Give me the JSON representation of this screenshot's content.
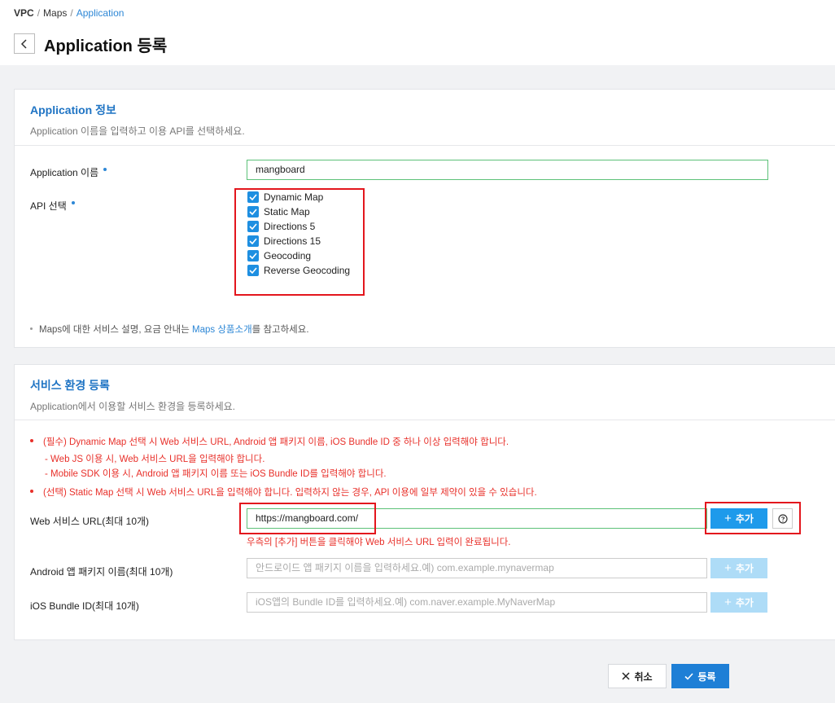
{
  "breadcrumb": {
    "root": "VPC",
    "sep1": "/",
    "section": "Maps",
    "sep2": "/",
    "current": "Application"
  },
  "page": {
    "title": "Application 등록"
  },
  "app_info": {
    "title": "Application 정보",
    "description": "Application 이름을 입력하고 이용 API를 선택하세요.",
    "name_label": "Application 이름",
    "name_value": "mangboard",
    "api_label": "API 선택",
    "apis": [
      {
        "label": "Dynamic Map",
        "checked": true
      },
      {
        "label": "Static Map",
        "checked": true
      },
      {
        "label": "Directions 5",
        "checked": true
      },
      {
        "label": "Directions 15",
        "checked": true
      },
      {
        "label": "Geocoding",
        "checked": true
      },
      {
        "label": "Reverse Geocoding",
        "checked": true
      }
    ],
    "note_prefix": "Maps에 대한 서비스 설명, 요금 안내는 ",
    "note_link": "Maps 상품소개",
    "note_suffix": "를 참고하세요."
  },
  "service_env": {
    "title": "서비스 환경 등록",
    "description": "Application에서 이용할 서비스 환경을 등록하세요.",
    "warnings": {
      "required": "(필수) Dynamic Map 선택 시 Web 서비스 URL, Android 앱 패키지 이름, iOS Bundle ID 중 하나 이상 입력해야 합니다.",
      "sub1": "- Web JS 이용 시, Web 서비스 URL을 입력해야 합니다.",
      "sub2": "- Mobile SDK 이용 시, Android 앱 패키지 이름 또는 iOS Bundle ID를 입력해야 합니다.",
      "optional": "(선택) Static Map 선택 시 Web 서비스 URL을 입력해야 합니다. 입력하지 않는 경우, API 이용에 일부 제약이 있을 수 있습니다."
    },
    "web_url": {
      "label": "Web 서비스 URL(최대 10개)",
      "value": "https://mangboard.com/",
      "add_label": "추가",
      "hint": "우측의 [추가] 버튼을 클릭해야 Web 서비스 URL 입력이 완료됩니다."
    },
    "android": {
      "label": "Android 앱 패키지 이름(최대 10개)",
      "placeholder": "안드로이드 앱 패키지 이름을 입력하세요.예) com.example.mynavermap",
      "add_label": "추가"
    },
    "ios": {
      "label": "iOS Bundle ID(최대 10개)",
      "placeholder": "iOS앱의 Bundle ID를 입력하세요.예) com.naver.example.MyNaverMap",
      "add_label": "추가"
    }
  },
  "footer": {
    "cancel_label": "취소",
    "submit_label": "등록"
  },
  "colors": {
    "accent": "#1e7fd6",
    "link": "#2d87d6",
    "warning": "#e8302a",
    "checkbox": "#1e8fe1",
    "highlight_outline": "#e3161d"
  }
}
